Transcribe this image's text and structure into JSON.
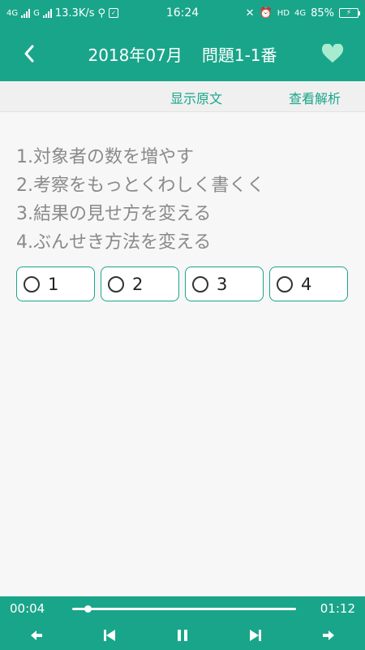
{
  "status_bar": {
    "net1": "4G",
    "net2": "G",
    "speed": "13.3K/s",
    "time": "16:24",
    "hd": "HD",
    "net3": "4G",
    "battery": "85%"
  },
  "header": {
    "title_date": "2018年07月",
    "title_question": "問題1-1番",
    "back_icon": "chevron-left-icon",
    "favorite_icon": "heart-icon"
  },
  "toolbar": {
    "show_original": "显示原文",
    "view_explanation": "查看解析"
  },
  "question": {
    "options": [
      "1.対象者の数を増やす",
      "2.考察をもっとくわしく書くく",
      "3.結果の見せ方を変える",
      "4.ぶんせき方法を変える"
    ]
  },
  "choices": [
    "1",
    "2",
    "3",
    "4"
  ],
  "player": {
    "current_time": "00:04",
    "total_time": "01:12",
    "progress": 0.07
  },
  "colors": {
    "accent": "#19a58a"
  }
}
